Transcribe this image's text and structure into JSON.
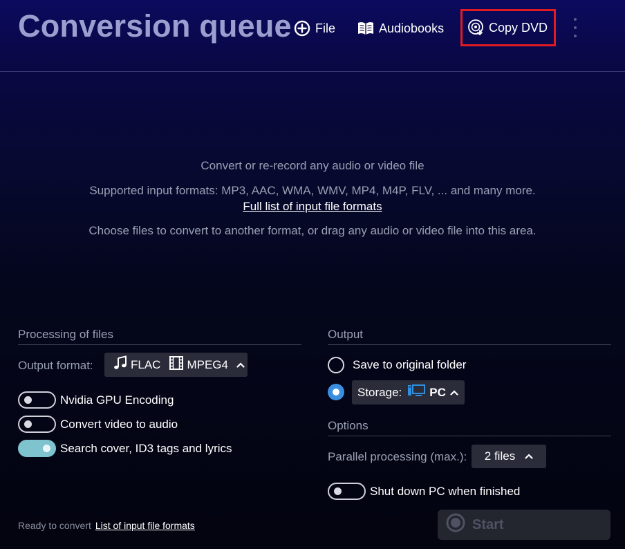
{
  "header": {
    "title": "Conversion queue",
    "buttons": {
      "file": "File",
      "audiobooks": "Audiobooks",
      "copy_dvd": "Copy DVD"
    }
  },
  "drop_area": {
    "line1": "Convert or re-record any audio or video file",
    "line2": "Supported input formats: MP3, AAC, WMA, WMV, MP4, M4P, FLV, ... and many more.",
    "link": "Full list of input file formats",
    "line3": "Choose files to convert to another format, or drag any audio or video file into this area."
  },
  "processing": {
    "heading": "Processing of files",
    "output_format_label": "Output format:",
    "audio_format": "FLAC",
    "video_format": "MPEG4",
    "toggles": [
      {
        "label": "Nvidia GPU Encoding",
        "on": false
      },
      {
        "label": "Convert video to audio",
        "on": false
      },
      {
        "label": "Search cover, ID3 tags and lyrics",
        "on": true
      }
    ]
  },
  "output": {
    "heading": "Output",
    "save_original": "Save to original folder",
    "storage_label": "Storage:",
    "storage_value": "PC",
    "selected": "storage"
  },
  "options": {
    "heading": "Options",
    "parallel_label": "Parallel processing (max.):",
    "parallel_value": "2 files",
    "shutdown_label": "Shut down PC when finished",
    "shutdown_on": false
  },
  "footer": {
    "status": "Ready to convert",
    "link": "List of input file formats"
  },
  "start_button": "Start",
  "colors": {
    "highlight_box": "#e01b24",
    "toggle_on": "#7fc3cf",
    "radio_selected": "#3a8ee0",
    "title": "#9a9fd0"
  }
}
